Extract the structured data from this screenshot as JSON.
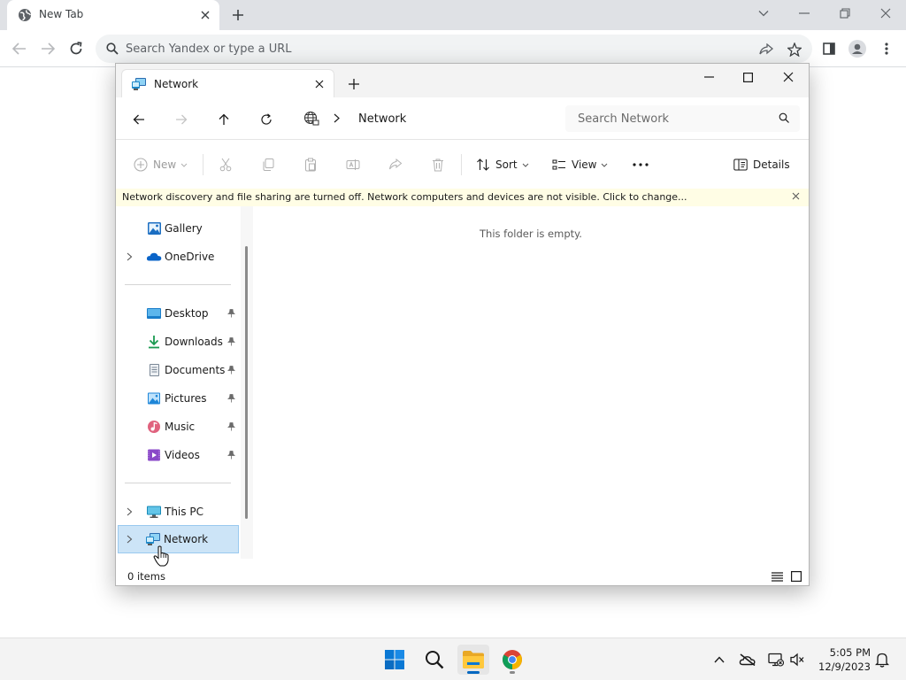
{
  "browser": {
    "tab_title": "New Tab",
    "omnibox_placeholder": "Search Yandex or type a URL"
  },
  "explorer": {
    "tab_title": "Network",
    "address": {
      "location": "Network"
    },
    "search_placeholder": "Search Network",
    "commands": {
      "new_label": "New",
      "sort_label": "Sort",
      "view_label": "View",
      "details_label": "Details"
    },
    "infobar_text": "Network discovery and file sharing are turned off. Network computers and devices are not visible. Click to change...",
    "nav": {
      "gallery": "Gallery",
      "onedrive": "OneDrive",
      "desktop": "Desktop",
      "downloads": "Downloads",
      "documents": "Documents",
      "pictures": "Pictures",
      "music": "Music",
      "videos": "Videos",
      "this_pc": "This PC",
      "network": "Network"
    },
    "empty_message": "This folder is empty.",
    "status_count": "0 items"
  },
  "taskbar": {
    "time": "5:05 PM",
    "date": "12/9/2023"
  },
  "colors": {
    "accent": "#0067c0",
    "selection": "#cce4f7",
    "infobar": "#fffde5"
  }
}
